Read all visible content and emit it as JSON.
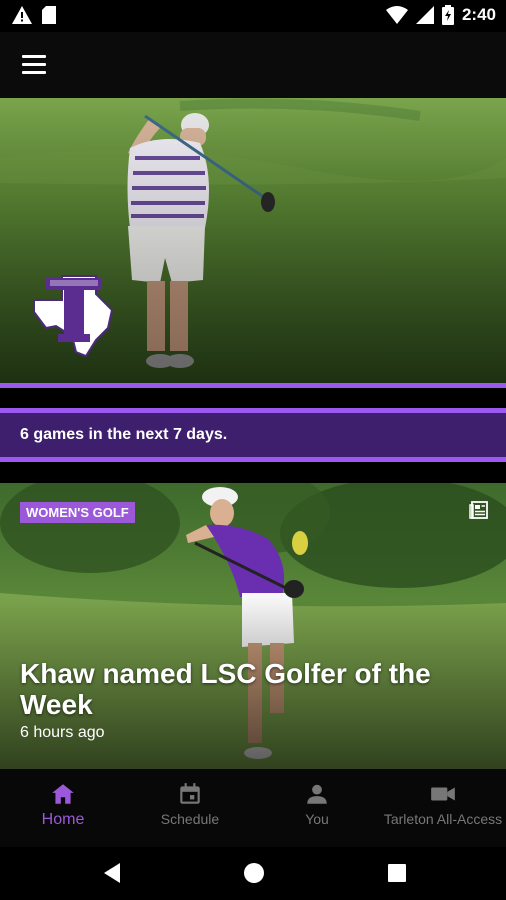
{
  "status_bar": {
    "time": "2:40"
  },
  "banner": {
    "games_text": "6 games in the next 7 days."
  },
  "news": {
    "tag": "WOMEN'S GOLF",
    "headline": "Khaw named LSC Golfer of the Week",
    "time_ago": "6 hours ago"
  },
  "bottom_nav": [
    {
      "label": "Home",
      "icon": "home-icon",
      "active": true
    },
    {
      "label": "Schedule",
      "icon": "calendar-icon",
      "active": false
    },
    {
      "label": "You",
      "icon": "person-icon",
      "active": false
    },
    {
      "label": "Tarleton All-Access",
      "icon": "video-camera-icon",
      "active": false
    }
  ],
  "colors": {
    "accent": "#9b59d9",
    "banner": "#3d1f6d",
    "stripe": "#9b59f0"
  }
}
